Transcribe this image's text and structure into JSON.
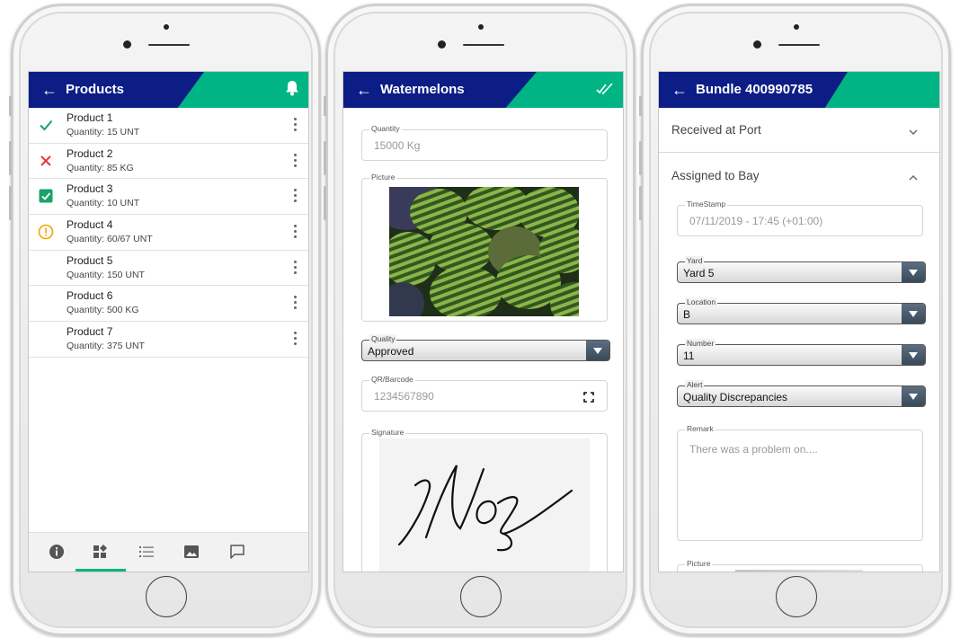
{
  "phone1": {
    "header": {
      "title": "Products",
      "back_icon": "arrow-left-icon",
      "action_icon": "bell-icon"
    },
    "products": [
      {
        "name": "Product 1",
        "quantity": "Quantity: 15 UNT",
        "status": "check",
        "status_color": "#1aa26b"
      },
      {
        "name": "Product 2",
        "quantity": "Quantity: 85 KG",
        "status": "cross",
        "status_color": "#e53935"
      },
      {
        "name": "Product 3",
        "quantity": "Quantity: 10 UNT",
        "status": "checkbox",
        "status_color": "#1aa26b"
      },
      {
        "name": "Product 4",
        "quantity": "Quantity: 60/67 UNT",
        "status": "warning",
        "status_color": "#f0a500"
      },
      {
        "name": "Product 5",
        "quantity": "Quantity: 150 UNT",
        "status": "none"
      },
      {
        "name": "Product 6",
        "quantity": "Quantity: 500 KG",
        "status": "none"
      },
      {
        "name": "Product 7",
        "quantity": "Quantity: 375 UNT",
        "status": "none"
      }
    ],
    "bottom_nav": [
      "info-icon",
      "dashboard-icon",
      "list-icon",
      "image-icon",
      "chat-icon"
    ],
    "active_nav": 1
  },
  "phone2": {
    "header": {
      "title": "Watermelons",
      "back_icon": "arrow-left-icon",
      "action_icon": "double-check-icon"
    },
    "quantity": {
      "label": "Quantity",
      "value": "15000 Kg"
    },
    "picture": {
      "label": "Picture"
    },
    "quality": {
      "label": "Quality",
      "value": "Approved"
    },
    "barcode": {
      "label": "QR/Barcode",
      "value": "1234567890",
      "icon": "scan-icon"
    },
    "signature": {
      "label": "Signature"
    }
  },
  "phone3": {
    "header": {
      "title": "Bundle 400990785",
      "back_icon": "arrow-left-icon"
    },
    "sections": [
      {
        "title": "Received at Port",
        "expanded": false
      },
      {
        "title": "Assigned to Bay",
        "expanded": true
      }
    ],
    "timestamp": {
      "label": "TimeStamp",
      "value": "07/11/2019 - 17:45 (+01:00)"
    },
    "yard": {
      "label": "Yard",
      "value": "Yard 5"
    },
    "location": {
      "label": "Location",
      "value": "B"
    },
    "number": {
      "label": "Number",
      "value": "11"
    },
    "alert": {
      "label": "Alert",
      "value": "Quality Discrepancies"
    },
    "remark": {
      "label": "Remark",
      "placeholder": "There was a problem on...."
    },
    "picture": {
      "label": "Picture"
    }
  },
  "colors": {
    "navy": "#0c1d86",
    "accent": "#00b483"
  }
}
